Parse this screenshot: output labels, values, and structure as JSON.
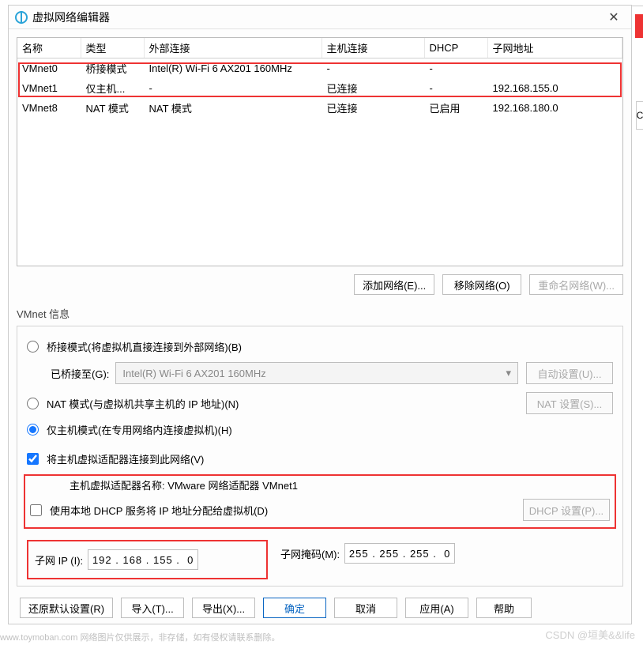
{
  "window": {
    "title": "虚拟网络编辑器"
  },
  "table": {
    "headers": {
      "name": "名称",
      "type": "类型",
      "ext": "外部连接",
      "host": "主机连接",
      "dhcp": "DHCP",
      "subnet": "子网地址"
    },
    "rows": [
      {
        "name": "VMnet0",
        "type": "桥接模式",
        "ext": "Intel(R) Wi-Fi 6 AX201 160MHz",
        "host": "-",
        "dhcp": "-",
        "subnet": ""
      },
      {
        "name": "VMnet1",
        "type": "仅主机...",
        "ext": "-",
        "host": "已连接",
        "dhcp": "-",
        "subnet": "192.168.155.0"
      },
      {
        "name": "VMnet8",
        "type": "NAT 模式",
        "ext": "NAT 模式",
        "host": "已连接",
        "dhcp": "已启用",
        "subnet": "192.168.180.0"
      }
    ]
  },
  "btns": {
    "add": "添加网络(E)...",
    "remove": "移除网络(O)",
    "rename": "重命名网络(W)..."
  },
  "group": {
    "title": "VMnet 信息"
  },
  "radio": {
    "bridged": "桥接模式(将虚拟机直接连接到外部网络)(B)",
    "bridged_to_label": "已桥接至(G):",
    "bridged_to_value": "Intel(R) Wi-Fi 6 AX201 160MHz",
    "auto": "自动设置(U)...",
    "nat": "NAT 模式(与虚拟机共享主机的 IP 地址)(N)",
    "nat_settings": "NAT 设置(S)...",
    "hostonly": "仅主机模式(在专用网络内连接虚拟机)(H)"
  },
  "check": {
    "host_adapter": "将主机虚拟适配器连接到此网络(V)",
    "adapter_name": "主机虚拟适配器名称: VMware 网络适配器 VMnet1",
    "dhcp": "使用本地 DHCP 服务将 IP 地址分配给虚拟机(D)",
    "dhcp_settings": "DHCP 设置(P)..."
  },
  "ip": {
    "subnet_label": "子网 IP (I):",
    "subnet_value": "192 . 168 . 155 .  0",
    "mask_label": "子网掩码(M):",
    "mask_value": "255 . 255 . 255 .  0"
  },
  "bottom": {
    "restore": "还原默认设置(R)",
    "import": "导入(T)...",
    "export": "导出(X)...",
    "ok": "确定",
    "cancel": "取消",
    "apply": "应用(A)",
    "help": "帮助"
  },
  "watermark": {
    "left": "www.toymoban.com 网络图片仅供展示，非存储，如有侵权请联系删除。",
    "right": "CSDN @垣美&&life"
  },
  "outer": {
    "c": "C"
  }
}
